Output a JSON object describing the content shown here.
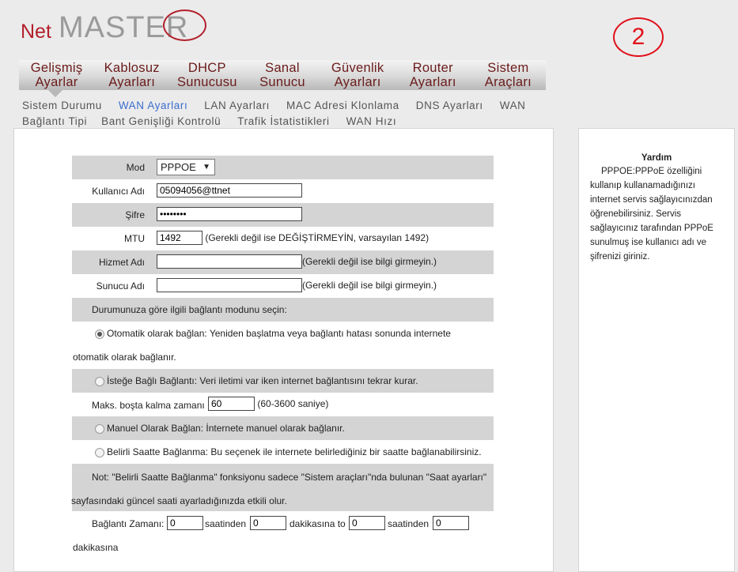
{
  "brand": {
    "logo_net": "Net",
    "logo_master": "MASTE",
    "logo_r": "R"
  },
  "badge": "2",
  "main_nav": [
    {
      "line1": "Gelişmiş",
      "line2": "Ayarlar"
    },
    {
      "line1": "Kablosuz",
      "line2": "Ayarları"
    },
    {
      "line1": "DHCP",
      "line2": "Sunucusu"
    },
    {
      "line1": "Sanal",
      "line2": "Sunucu"
    },
    {
      "line1": "Güvenlik",
      "line2": "Ayarları"
    },
    {
      "line1": "Router",
      "line2": "Ayarları"
    },
    {
      "line1": "Sistem",
      "line2": "Araçları"
    }
  ],
  "sub_nav": [
    "Sistem Durumu",
    "WAN Ayarları",
    "LAN Ayarları",
    "MAC Adresi Klonlama",
    "DNS Ayarları",
    "WAN Bağlantı Tipi",
    "Bant Genişliği Kontrolü",
    "Trafik İstatistikleri",
    "WAN Hızı"
  ],
  "sub_nav_parts": {
    "wan": "WAN",
    "baglanti_tipi": "Bağlantı Tipi"
  },
  "form": {
    "mode_label": "Mod",
    "mode_value": "PPPOE",
    "username_label": "Kullanıcı Adı",
    "username_value": "05094056@ttnet",
    "password_label": "Şifre",
    "password_value": "••••••••",
    "mtu_label": "MTU",
    "mtu_value": "1492",
    "mtu_hint": "(Gerekli değil ise DEĞİŞTİRMEYİN, varsayılan 1492)",
    "service_label": "Hizmet Adı",
    "service_value": "",
    "service_hint": "(Gerekli değil ise bilgi girmeyin.)",
    "server_label": "Sunucu Adı",
    "server_value": "",
    "server_hint": "(Gerekli değil ise bilgi girmeyin.)",
    "choose_text": "Durumunuza göre ilgili bağlantı modunu seçin:",
    "opt_auto_line1": "Otomatik olarak bağlan: Yeniden başlatma veya bağlantı hatası sonunda internete",
    "opt_auto_line2": "otomatik olarak bağlanır.",
    "opt_demand": "İsteğe Bağlı Bağlantı: Veri iletimi var iken internet bağlantısını tekrar kurar.",
    "idle_label": "Maks. boşta kalma zamanı",
    "idle_value": "60",
    "idle_hint": "(60-3600 saniye)",
    "opt_manual": "Manuel Olarak Bağlan: İnternete manuel olarak bağlanır.",
    "opt_schedule": "Belirli Saatte Bağlanma: Bu seçenek ile internete belirlediğiniz bir saatte bağlanabilirsiniz.",
    "note_line1": "Not: \"Belirli Saatte Bağlanma\" fonksiyonu sadece \"Sistem araçları\"nda bulunan \"Saat ayarları\"",
    "note_line2": "sayfasındaki güncel saati ayarladığınızda etkili olur.",
    "time_label": "Bağlantı Zamanı:",
    "time_h1": "0",
    "saatinden": "saatinden",
    "time_m1": "0",
    "dakikasina_to": "dakikasına to",
    "time_h2": "0",
    "saatinden2": "saatinden",
    "time_m2": "0",
    "dakikasina": "dakikasına"
  },
  "help": {
    "title": "Yardım",
    "text": "PPPOE:PPPoE özelliğini kullanıp kullanamadığınızı internet servis sağlayıcınızdan öğrenebilirsiniz. Servis sağlayıcınız tarafından PPPoE sunulmuş ise kullanıcı adı ve şifrenizi giriniz."
  },
  "colors": {
    "brand_red": "#b2202c",
    "nav_text": "#6b1b1b",
    "active_sub": "#3b6ccd",
    "badge_red": "#e0101a"
  }
}
